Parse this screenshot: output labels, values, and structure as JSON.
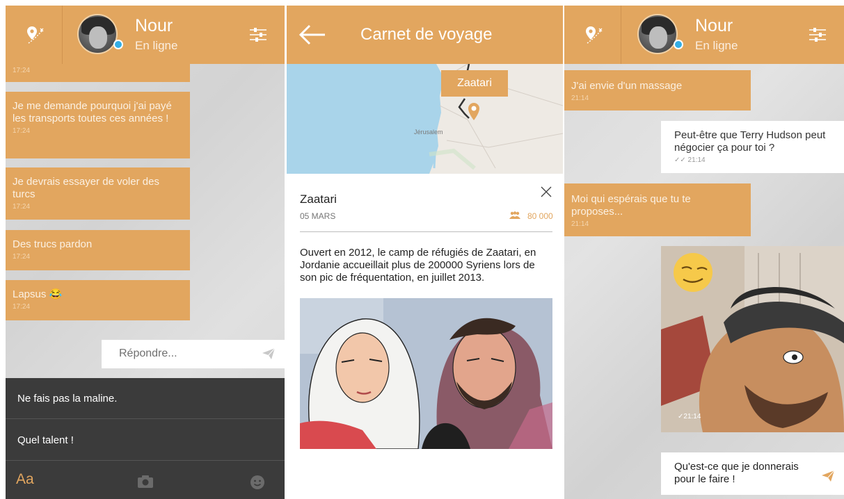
{
  "contact": {
    "name": "Nour",
    "status": "En ligne"
  },
  "left_chat": {
    "messages": [
      {
        "text": "",
        "time": "17:24"
      },
      {
        "text": "Je me demande pourquoi j'ai payé les transports toutes ces années !",
        "time": "17:24"
      },
      {
        "text": "Je devrais essayer de voler des turcs",
        "time": "17:24"
      },
      {
        "text": "Des trucs pardon",
        "time": "17:24"
      },
      {
        "text": "Lapsus 😂",
        "time": "17:24"
      }
    ],
    "reply_placeholder": "Répondre...",
    "suggestions": [
      "Ne fais pas la maline.",
      "Quel talent !"
    ],
    "keyboard_label": "Aa"
  },
  "travel_log": {
    "title": "Carnet de voyage",
    "map_label": "Zaatari",
    "map_city": "Jérusalem",
    "card": {
      "title": "Zaatari",
      "date": "05 MARS",
      "count": "80 000",
      "description": "Ouvert en 2012, le camp de réfugiés de Zaatari, en Jordanie accueillait plus de 200000 Syriens lors de son pic de fréquentation, en juillet 2013."
    }
  },
  "right_chat": {
    "messages": [
      {
        "text": "J'ai envie d'un massage",
        "time": "21:14"
      },
      {
        "text": "Peut-être que Terry Hudson peut négocier ça pour toi ?",
        "time": "✓✓ 21:14"
      },
      {
        "text": "Moi qui espérais que tu te proposes...",
        "time": "21:14"
      }
    ],
    "image_time": "✓21:14",
    "reply_text": "Qu'est-ce que je donnerais pour le faire !"
  },
  "colors": {
    "accent": "#e2a65f",
    "dark": "#3b3b3b",
    "online": "#34aee6"
  }
}
